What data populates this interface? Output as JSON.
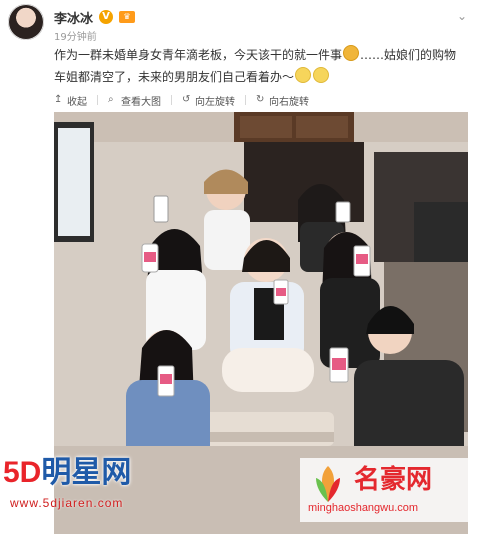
{
  "post": {
    "username": "李冰冰",
    "verified_badge": "V",
    "vip_icon": "vip-icon",
    "timestamp": "19分钟前",
    "text_part1": "作为一群未婚单身女青年滴老板，今天该干的就一件事",
    "text_part2": "……姑娘们的购物车姐都清空了，未来的男朋友们自己看着办～",
    "actions": [
      {
        "label": "收起",
        "icon": "collapse-icon"
      },
      {
        "label": "查看大图",
        "icon": "zoom-icon"
      },
      {
        "label": "向左旋转",
        "icon": "rotate-left-icon"
      },
      {
        "label": "向右旋转",
        "icon": "rotate-right-icon"
      }
    ]
  },
  "watermarks": {
    "left_logo_red": "5D",
    "left_logo_blue": "明星网",
    "left_url": "www.5djiaren.com",
    "right_title": "名豪网",
    "right_url": "minghaoshangwu.com"
  },
  "colors": {
    "accent_red": "#e4282e",
    "brand_blue": "#1f5aa8",
    "verified": "#f5a300"
  }
}
